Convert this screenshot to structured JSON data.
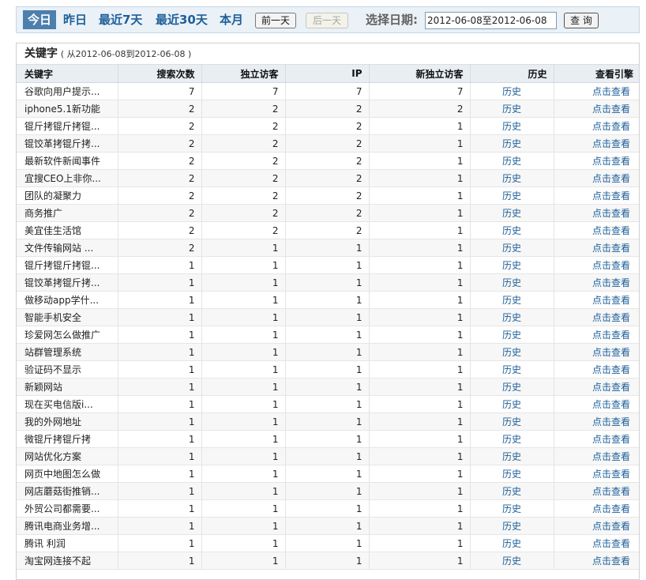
{
  "toolbar": {
    "today": "今日",
    "yesterday": "昨日",
    "last7": "最近7天",
    "last30": "最近30天",
    "this_month": "本月",
    "prev_day": "前一天",
    "next_day": "后一天",
    "date_label": "选择日期:",
    "date_value": "2012-06-08至2012-06-08",
    "query": "查 询"
  },
  "panel": {
    "title": "关键字",
    "range": "( 从2012-06-08到2012-06-08 )"
  },
  "table": {
    "columns": [
      "关键字",
      "搜索次数",
      "独立访客",
      "IP",
      "新独立访客",
      "历史",
      "查看引擎"
    ],
    "history_label": "历史",
    "engine_label": "点击查看",
    "rows": [
      [
        "谷歌向用户提示...",
        7,
        7,
        7,
        7
      ],
      [
        "iphone5.1新功能",
        2,
        2,
        2,
        2
      ],
      [
        "锟斤拷锟斤拷锟...",
        2,
        2,
        2,
        1
      ],
      [
        "锟饺革拷锟斤拷...",
        2,
        2,
        2,
        1
      ],
      [
        "最新软件新闻事件",
        2,
        2,
        2,
        1
      ],
      [
        "宜搜CEO上非你...",
        2,
        2,
        2,
        1
      ],
      [
        "团队的凝聚力",
        2,
        2,
        2,
        1
      ],
      [
        "商务推广",
        2,
        2,
        2,
        1
      ],
      [
        "美宜佳生活馆",
        2,
        2,
        2,
        1
      ],
      [
        "文件传输网站 ...",
        2,
        1,
        1,
        1
      ],
      [
        "锟斤拷锟斤拷锟...",
        1,
        1,
        1,
        1
      ],
      [
        "锟饺革拷锟斤拷...",
        1,
        1,
        1,
        1
      ],
      [
        "做移动app学什...",
        1,
        1,
        1,
        1
      ],
      [
        "智能手机安全",
        1,
        1,
        1,
        1
      ],
      [
        "珍爱网怎么做推广",
        1,
        1,
        1,
        1
      ],
      [
        "站群管理系统",
        1,
        1,
        1,
        1
      ],
      [
        "验证码不显示",
        1,
        1,
        1,
        1
      ],
      [
        "新颖网站",
        1,
        1,
        1,
        1
      ],
      [
        "现在买电信版i...",
        1,
        1,
        1,
        1
      ],
      [
        "我的外网地址",
        1,
        1,
        1,
        1
      ],
      [
        "微锟斤拷锟斤拷",
        1,
        1,
        1,
        1
      ],
      [
        "网站优化方案",
        1,
        1,
        1,
        1
      ],
      [
        "网页中地图怎么做",
        1,
        1,
        1,
        1
      ],
      [
        "网店蘑菇街推销...",
        1,
        1,
        1,
        1
      ],
      [
        "外贸公司都需要...",
        1,
        1,
        1,
        1
      ],
      [
        "腾讯电商业务增...",
        1,
        1,
        1,
        1
      ],
      [
        "腾讯 利润",
        1,
        1,
        1,
        1
      ],
      [
        "淘宝网连接不起",
        1,
        1,
        1,
        1
      ]
    ]
  }
}
